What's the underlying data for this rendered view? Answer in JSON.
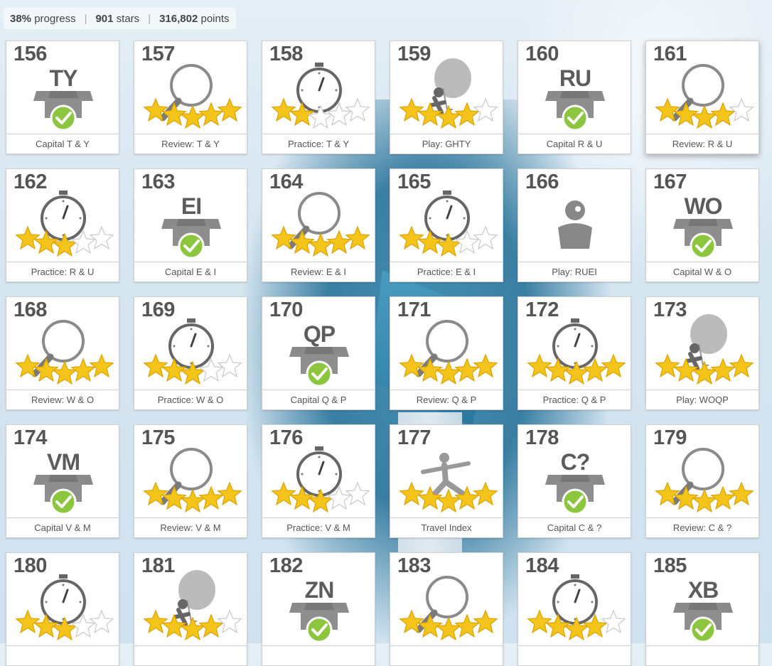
{
  "status": {
    "progress_value": "38%",
    "progress_label": "progress",
    "stars_value": "901",
    "stars_label": "stars",
    "points_value": "316,802",
    "points_label": "points"
  },
  "lessons": [
    {
      "num": "156",
      "type": "capital",
      "letters": "TY",
      "label": "Capital T & Y"
    },
    {
      "num": "157",
      "type": "review",
      "stars": 5,
      "label": "Review: T & Y"
    },
    {
      "num": "158",
      "type": "practice",
      "stars": 2,
      "label": "Practice: T & Y"
    },
    {
      "num": "159",
      "type": "play",
      "stars": 4,
      "label": "Play: GHTY"
    },
    {
      "num": "160",
      "type": "capital",
      "letters": "RU",
      "label": "Capital R & U"
    },
    {
      "num": "161",
      "type": "review",
      "stars": 4,
      "label": "Review: R & U"
    },
    {
      "num": "162",
      "type": "practice",
      "stars": 3,
      "label": "Practice: R & U"
    },
    {
      "num": "163",
      "type": "capital",
      "letters": "EI",
      "label": "Capital E & I"
    },
    {
      "num": "164",
      "type": "review",
      "stars": 5,
      "label": "Review: E & I"
    },
    {
      "num": "165",
      "type": "practice",
      "stars": 3,
      "label": "Practice: E & I"
    },
    {
      "num": "166",
      "type": "play-locked",
      "stars": 0,
      "label": "Play: RUEI"
    },
    {
      "num": "167",
      "type": "capital",
      "letters": "WO",
      "label": "Capital W & O"
    },
    {
      "num": "168",
      "type": "review",
      "stars": 5,
      "label": "Review: W & O"
    },
    {
      "num": "169",
      "type": "practice",
      "stars": 3,
      "label": "Practice: W & O"
    },
    {
      "num": "170",
      "type": "capital",
      "letters": "QP",
      "label": "Capital Q & P"
    },
    {
      "num": "171",
      "type": "review",
      "stars": 5,
      "label": "Review: Q & P"
    },
    {
      "num": "172",
      "type": "practice",
      "stars": 5,
      "label": "Practice: Q & P"
    },
    {
      "num": "173",
      "type": "play",
      "stars": 5,
      "label": "Play: WOQP"
    },
    {
      "num": "174",
      "type": "capital",
      "letters": "VM",
      "label": "Capital V & M"
    },
    {
      "num": "175",
      "type": "review",
      "stars": 5,
      "label": "Review: V & M"
    },
    {
      "num": "176",
      "type": "practice",
      "stars": 3,
      "label": "Practice: V & M"
    },
    {
      "num": "177",
      "type": "travel",
      "stars": 5,
      "label": "Travel Index"
    },
    {
      "num": "178",
      "type": "capital",
      "letters": "C?",
      "label": "Capital C & ?"
    },
    {
      "num": "179",
      "type": "review",
      "stars": 5,
      "label": "Review: C & ?"
    },
    {
      "num": "180",
      "type": "practice",
      "stars": 3,
      "label": ""
    },
    {
      "num": "181",
      "type": "play",
      "stars": 4,
      "label": ""
    },
    {
      "num": "182",
      "type": "capital",
      "letters": "ZN",
      "label": ""
    },
    {
      "num": "183",
      "type": "review",
      "stars": 5,
      "label": ""
    },
    {
      "num": "184",
      "type": "practice",
      "stars": 4,
      "label": ""
    },
    {
      "num": "185",
      "type": "capital",
      "letters": "XB",
      "label": ""
    }
  ],
  "colors": {
    "star_fill": "#f4c41a",
    "star_empty": "#ffffff",
    "check": "#8cc63f",
    "icon_gray": "#7a7a7a"
  }
}
